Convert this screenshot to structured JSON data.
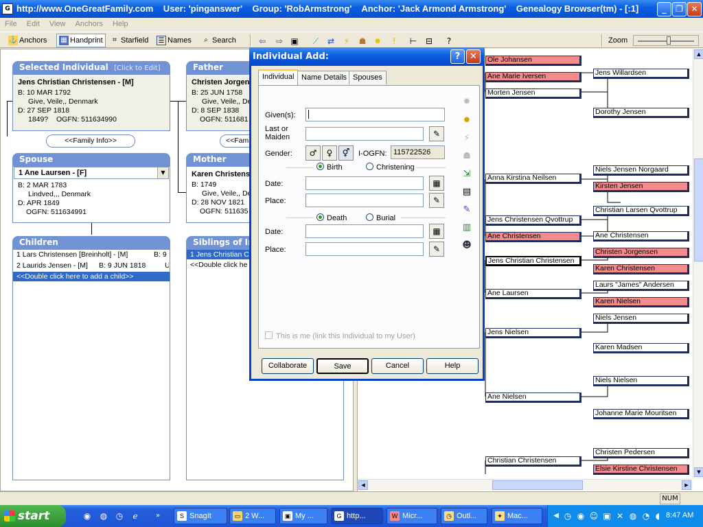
{
  "window": {
    "title": "http://www.OneGreatFamily.com    User: 'pinganswer'    Group: 'RobArmstrong'    Anchor: 'Jack Armond Armstrong'    Genealogy Browser(tm) - [:1]"
  },
  "menu": [
    "File",
    "Edit",
    "View",
    "Anchors",
    "Help"
  ],
  "toolbar": {
    "anchors": "Anchors",
    "handprint": "Handprint",
    "starfield": "Starfield",
    "names": "Names",
    "search": "Search",
    "zoom": "Zoom"
  },
  "selected": {
    "header": "Selected Individual",
    "click_to_edit": "[Click to Edit]",
    "name": "Jens Christian Christensen - [M]",
    "birth": "B: 10 MAR 1792",
    "birth_place": "Give, Veile,, Denmark",
    "death": "D: 27 SEP 1818",
    "death_extra": "1849?",
    "ogfn": "OGFN: 511634990"
  },
  "family_info_button": "<<Family Info>>",
  "father": {
    "header": "Father",
    "name": "Christen Jorgen",
    "birth": "B: 25 JUN 1758",
    "birth_place": "Give, Veile,, De",
    "death": "D: 8 SEP 1838",
    "ogfn": "OGFN: 511681"
  },
  "father_family_button": "<<Fami",
  "spouse": {
    "header": "Spouse",
    "name": "1 Ane Laursen - [F]",
    "birth": "B: 2 MAR 1783",
    "birth_place": "Lindved,,, Denmark",
    "death": "D: APR 1849",
    "ogfn": "OGFN: 511634991"
  },
  "mother": {
    "header": "Mother",
    "name": "Karen Christens",
    "birth": "B: 1749",
    "birth_place": "Give, Veile,, De",
    "death": "D: 28 NOV 1821",
    "ogfn": "OGFN: 511635"
  },
  "children": {
    "header": "Children",
    "rows": [
      {
        "name": "1 Lars Christensen [Breinholt] - [M]",
        "birth": "B: 9"
      },
      {
        "name": "2 Laurids Jensen - [M]",
        "birth": "B: 9 JUN 1818",
        "extra": "U"
      }
    ],
    "add_row": "<<Double click here to add a child>>"
  },
  "siblings": {
    "header": "Siblings of In",
    "rows": [
      "1 Jens Christian Ch"
    ],
    "add_row": "<<Double click he"
  },
  "tree": {
    "col1": [
      "Ole Johansen",
      "Ane Marie Iversen",
      "Morten Jensen",
      "Anna Kirstina Neilsen",
      "Jens Christensen Qvottrup",
      "Ane Christensen",
      "Jens Christian Christensen",
      "Ane Laursen",
      "Jens Nielsen",
      "Ane Nielsen",
      "Christian Christensen"
    ],
    "col2": [
      "Jens Willardsen",
      "Dorothy Jensen",
      "Niels Jensen Norgaard",
      "Kirsten Jensen",
      "Christian Larsen Qvottrup",
      "Ane Christensen",
      "Christen Jorgensen",
      "Karen Christensen",
      "Laurs \"James\" Andersen",
      "Karen Nielsen",
      "Niels Jensen",
      "Karen Madsen",
      "Niels Nielsen",
      "Johanne Marie Mouritsen",
      "Christen Pedersen",
      "Elsie Kirstine Christensen"
    ]
  },
  "dialog": {
    "title": "Individual Add:",
    "tabs": [
      "Individual",
      "Name Details",
      "Spouses"
    ],
    "given_label": "Given(s):",
    "last_label_1": "Last or",
    "last_label_2": "Maiden",
    "gender_label": "Gender:",
    "iogfn_label": "I-OGFN:",
    "iogfn_value": "115722526",
    "birth_radio": "Birth",
    "christening_radio": "Christening",
    "date_label": "Date:",
    "place_label": "Place:",
    "death_radio": "Death",
    "burial_radio": "Burial",
    "date2_label": "Date:",
    "place2_label": "Place:",
    "this_is_me": "This is me (link this Individual to my User)",
    "buttons": {
      "collaborate": "Collaborate",
      "save": "Save",
      "cancel": "Cancel",
      "help": "Help"
    }
  },
  "status": {
    "num": "NUM"
  },
  "taskbar": {
    "start": "start",
    "tasks": [
      "SnagIt",
      "2 W...",
      "My ...",
      "http...",
      "Micr...",
      "Outl...",
      "Mac..."
    ],
    "clock": "8:47 AM"
  },
  "colors": {
    "accent": "#7193d4",
    "selection": "#316ac5",
    "female_box": "#f28b8b"
  }
}
